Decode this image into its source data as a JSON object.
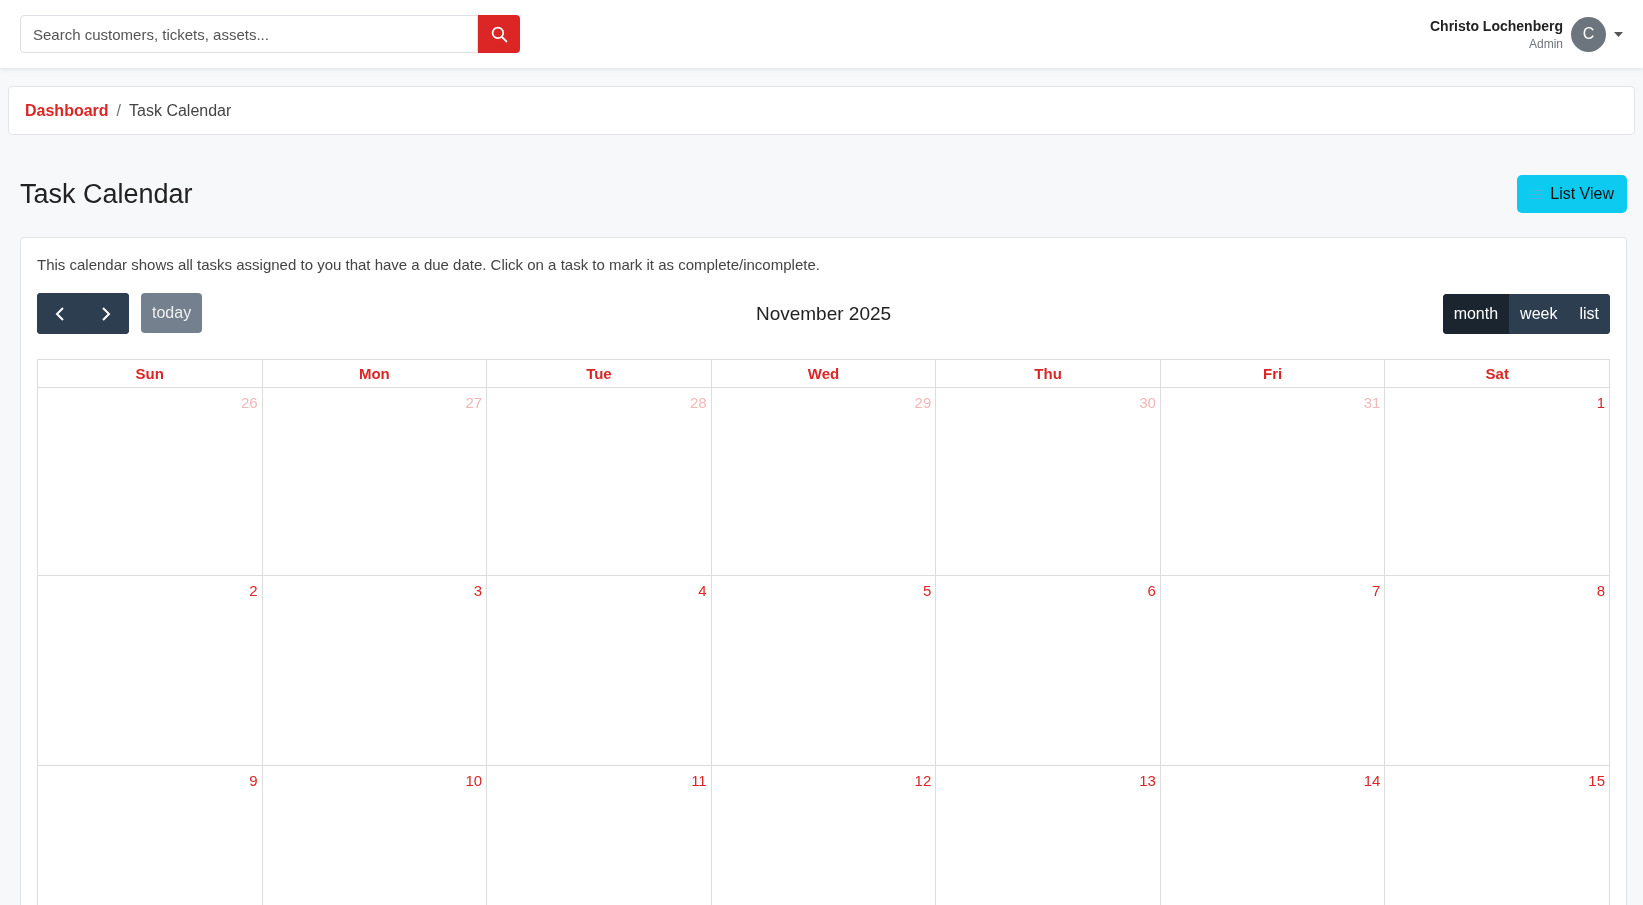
{
  "search": {
    "placeholder": "Search customers, tickets, assets..."
  },
  "user": {
    "name": "Christo Lochenberg",
    "role": "Admin",
    "initial": "C"
  },
  "breadcrumb_separator": "/",
  "breadcrumb": [
    {
      "label": "Dashboard",
      "kind": "link"
    },
    {
      "label": "Task Calendar",
      "kind": "current"
    }
  ],
  "page_title": "Task Calendar",
  "list_view_button": "List View",
  "description": "This calendar shows all tasks assigned to you that have a due date. Click on a task to mark it as complete/incomplete.",
  "toolbar": {
    "today": "today",
    "today_disabled": true,
    "title": "November 2025",
    "views": [
      {
        "label": "month",
        "selected": true
      },
      {
        "label": "week",
        "selected": false
      },
      {
        "label": "list",
        "selected": false
      }
    ]
  },
  "weekdays": [
    "Sun",
    "Mon",
    "Tue",
    "Wed",
    "Thu",
    "Fri",
    "Sat"
  ],
  "weeks": [
    [
      {
        "day": "26",
        "other_month": true
      },
      {
        "day": "27",
        "other_month": true
      },
      {
        "day": "28",
        "other_month": true
      },
      {
        "day": "29",
        "other_month": true
      },
      {
        "day": "30",
        "other_month": true
      },
      {
        "day": "31",
        "other_month": true
      },
      {
        "day": "1",
        "other_month": false
      }
    ],
    [
      {
        "day": "2",
        "other_month": false
      },
      {
        "day": "3",
        "other_month": false
      },
      {
        "day": "4",
        "other_month": false
      },
      {
        "day": "5",
        "other_month": false
      },
      {
        "day": "6",
        "other_month": false
      },
      {
        "day": "7",
        "other_month": false
      },
      {
        "day": "8",
        "other_month": false
      }
    ],
    [
      {
        "day": "9",
        "other_month": false
      },
      {
        "day": "10",
        "other_month": false
      },
      {
        "day": "11",
        "other_month": false
      },
      {
        "day": "12",
        "other_month": false
      },
      {
        "day": "13",
        "other_month": false
      },
      {
        "day": "14",
        "other_month": false
      },
      {
        "day": "15",
        "other_month": false
      }
    ]
  ]
}
